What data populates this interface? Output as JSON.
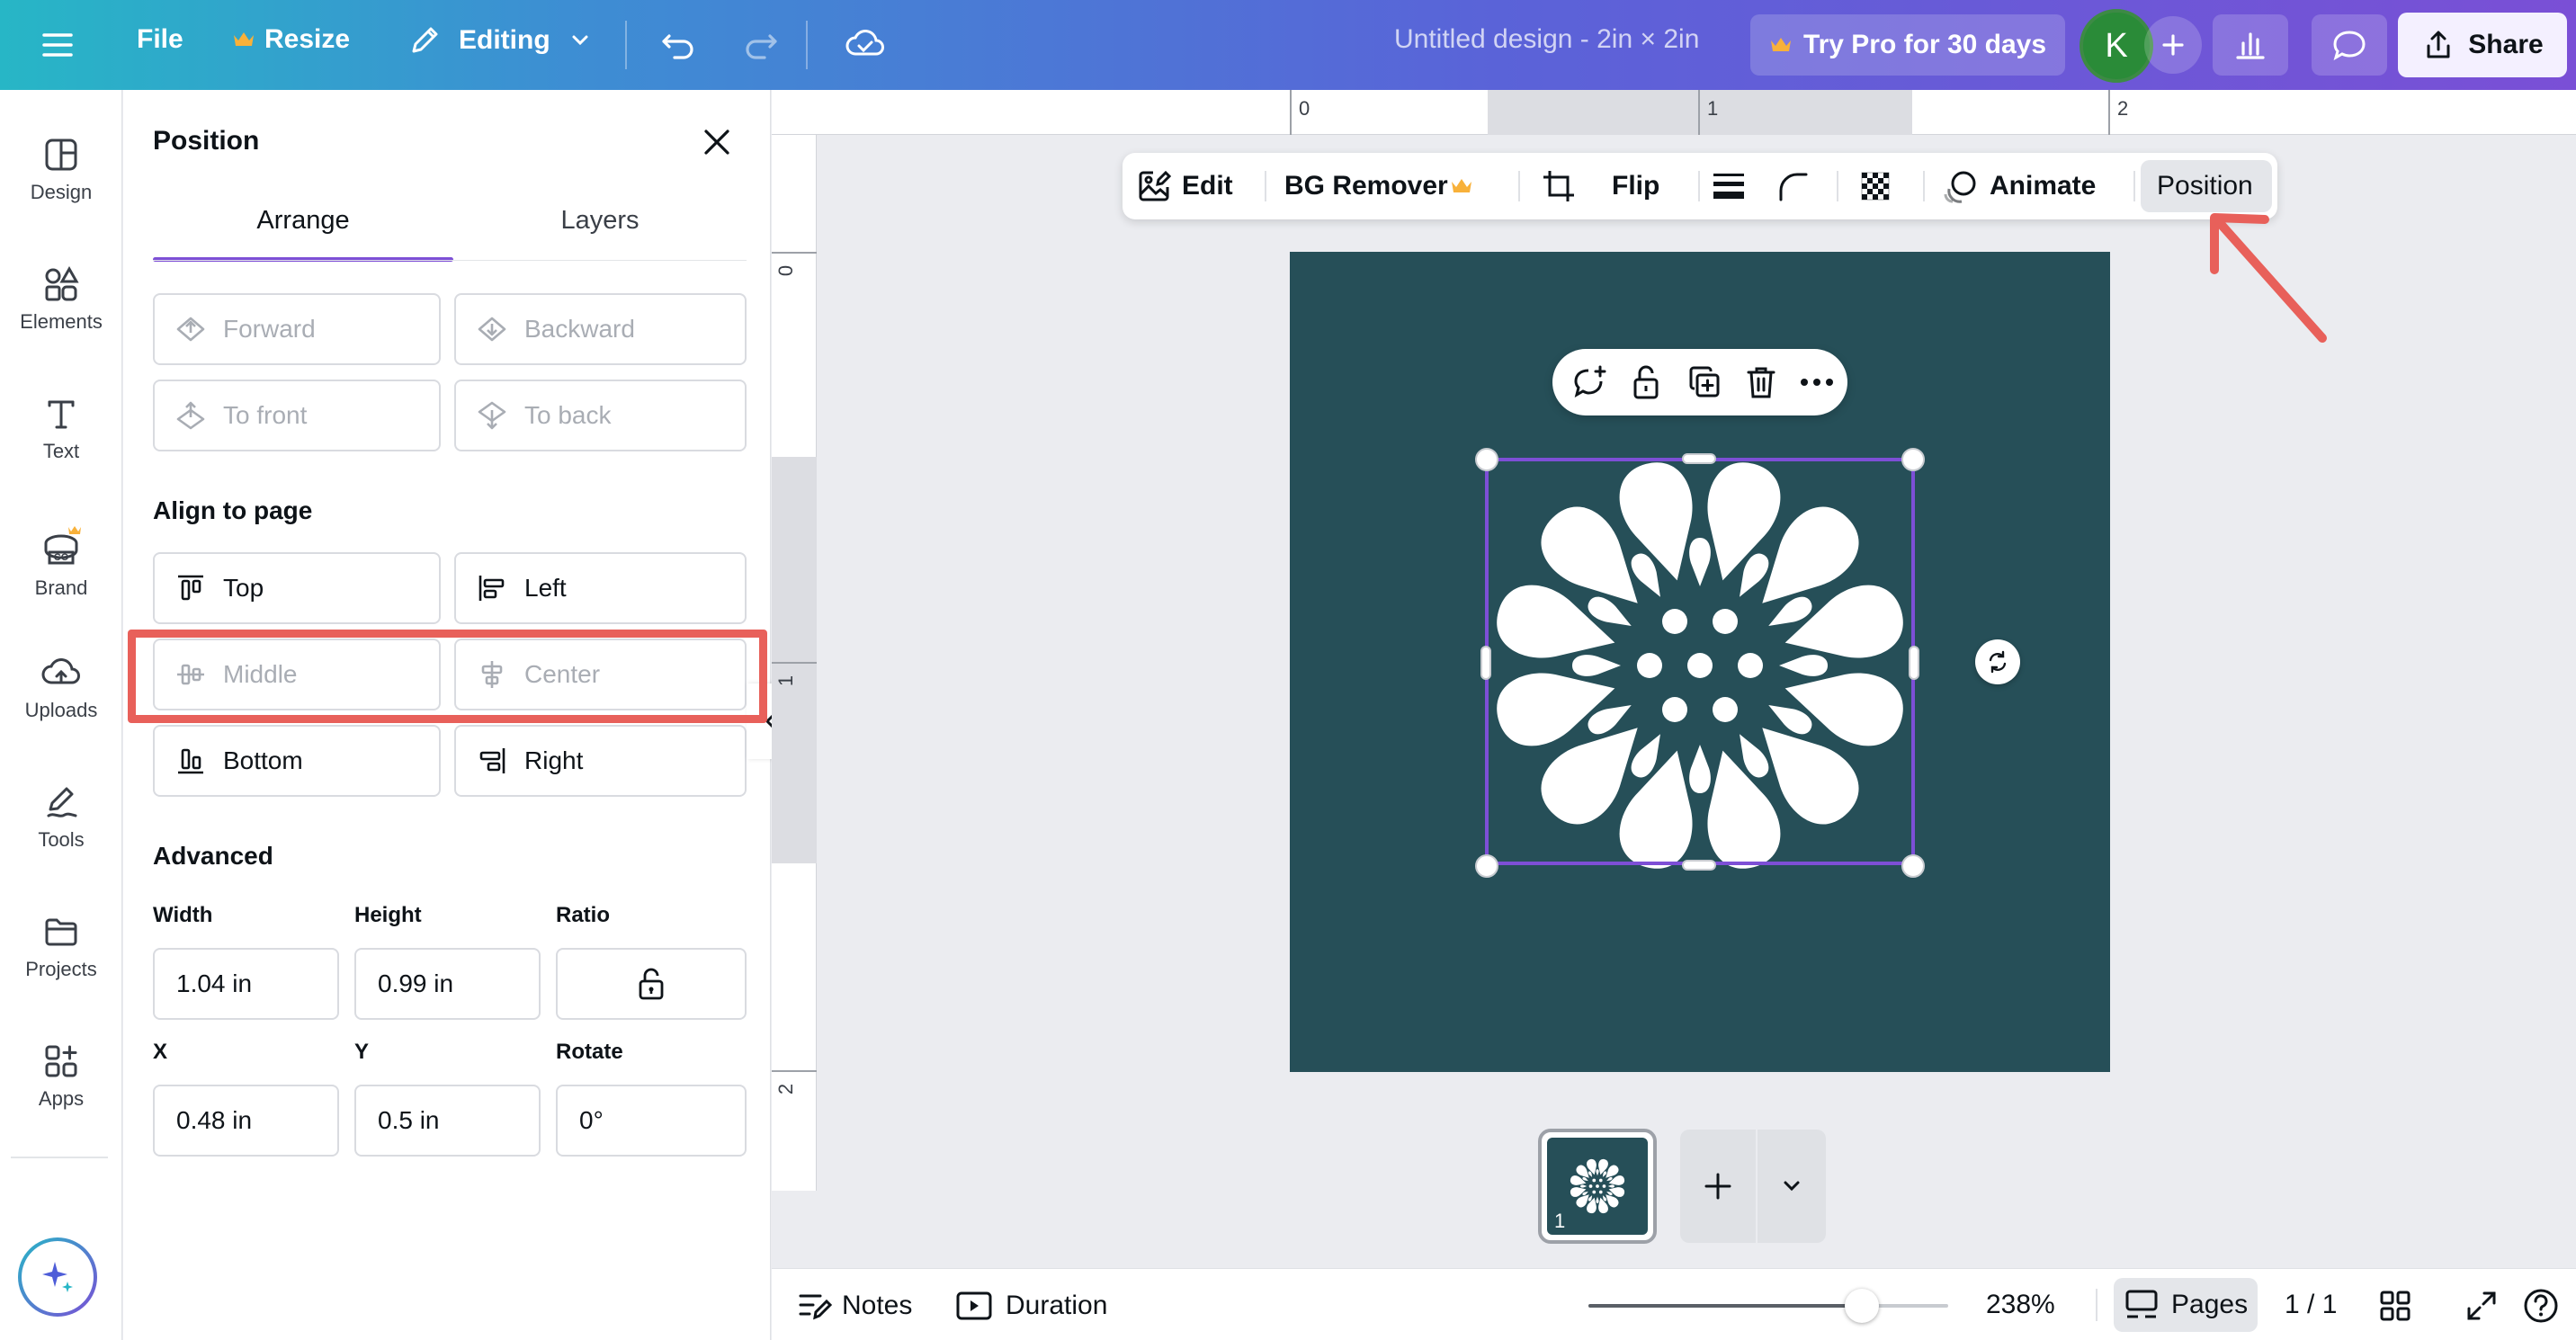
{
  "topbar": {
    "menu_icon": "hamburger-icon",
    "file_label": "File",
    "resize_label": "Resize",
    "editing_label": "Editing",
    "doc_title": "Untitled design - 2in × 2in",
    "try_pro_label": "Try Pro for 30 days",
    "avatar_initial": "K",
    "share_label": "Share",
    "crown_color": "#f8b13a"
  },
  "rail": {
    "items": [
      {
        "label": "Design",
        "icon": "design-icon"
      },
      {
        "label": "Elements",
        "icon": "elements-icon"
      },
      {
        "label": "Text",
        "icon": "text-icon"
      },
      {
        "label": "Brand",
        "icon": "brand-icon"
      },
      {
        "label": "Uploads",
        "icon": "uploads-icon"
      },
      {
        "label": "Tools",
        "icon": "tools-icon"
      },
      {
        "label": "Projects",
        "icon": "projects-icon"
      },
      {
        "label": "Apps",
        "icon": "apps-icon"
      }
    ]
  },
  "panel": {
    "title": "Position",
    "tabs": {
      "arrange": "Arrange",
      "layers": "Layers"
    },
    "order": {
      "forward": "Forward",
      "backward": "Backward",
      "to_front": "To front",
      "to_back": "To back"
    },
    "align_title": "Align to page",
    "align": {
      "top": "Top",
      "left": "Left",
      "middle": "Middle",
      "center": "Center",
      "bottom": "Bottom",
      "right": "Right"
    },
    "advanced_title": "Advanced",
    "fields": {
      "width_label": "Width",
      "width": "1.04 in",
      "height_label": "Height",
      "height": "0.99 in",
      "ratio_label": "Ratio",
      "x_label": "X",
      "x": "0.48 in",
      "y_label": "Y",
      "y": "0.5 in",
      "rotate_label": "Rotate",
      "rotate": "0°"
    }
  },
  "ruler": {
    "h": [
      "0",
      "1",
      "2"
    ],
    "v": [
      "0",
      "1",
      "2"
    ]
  },
  "context_toolbar": {
    "edit": "Edit",
    "bg_remover": "BG Remover",
    "flip": "Flip",
    "animate": "Animate",
    "position": "Position"
  },
  "canvas": {
    "background": "#264f58",
    "selection_color": "#7d4fd6"
  },
  "annotation": {
    "highlight_color": "#e8605a"
  },
  "pages": {
    "thumb_number": "1"
  },
  "bottombar": {
    "notes": "Notes",
    "duration": "Duration",
    "zoom": "238%",
    "zoom_fraction": 0.76,
    "pages": "Pages",
    "page_count": "1 / 1"
  }
}
